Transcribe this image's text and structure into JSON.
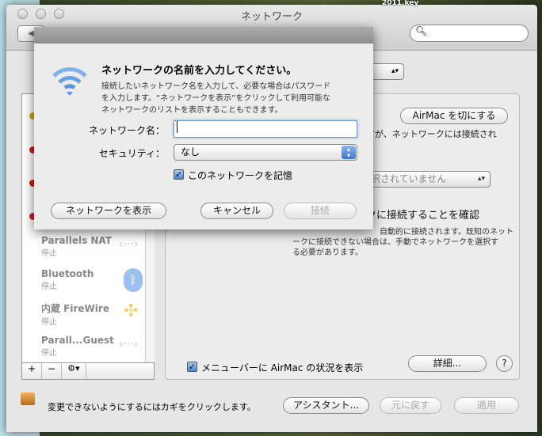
{
  "window": {
    "title": "ネットワーク",
    "search_placeholder": ""
  },
  "desktop": {
    "label": "2011.key"
  },
  "sidebar": {
    "items": [
      {
        "name": "Parallels NAT",
        "status": "停止",
        "icon": "ethernet-icon"
      },
      {
        "name": "Bluetooth",
        "status": "停止",
        "icon": "bluetooth-icon"
      },
      {
        "name": "内蔵 FireWire",
        "status": "停止",
        "icon": "firewire-icon"
      },
      {
        "name": "Parall...Guest",
        "status": "停止",
        "icon": "ethernet-icon"
      }
    ],
    "add": "+",
    "remove": "−",
    "gear": "⚙▾"
  },
  "panel": {
    "airmac_off": "AirMac を切にする",
    "status_text": "ますが、ネットワークには接続され",
    "network_popup": "択されていません",
    "ask_label": "クに接続することを確認",
    "ask_desc1": "自動的に接続されます。既知のネット",
    "ask_desc2": "ークに接続できない場合は、手動でネットワークを選択す",
    "ask_desc3": "る必要があります。",
    "menubar_checkbox": "メニューバーに AirMac の状況を表示",
    "menubar_checked": true,
    "advanced": "詳細...",
    "help": "?"
  },
  "footer": {
    "lock_text": "変更できないようにするにはカギをクリックします。",
    "assistant": "アシスタント...",
    "revert": "元に戻す",
    "apply": "適用"
  },
  "sheet": {
    "title": "ネットワークの名前を入力してください。",
    "desc1": "接続したいネットワーク名を入力して、必要な場合はパスワード",
    "desc2": "を入力します。“ネットワークを表示”をクリックして利用可能な",
    "desc3": "ネットワークのリストを表示することもできます。",
    "name_label": "ネットワーク名：",
    "name_value": "",
    "security_label": "セキュリティ：",
    "security_value": "なし",
    "remember": "このネットワークを記憶",
    "remember_checked": true,
    "show_networks": "ネットワークを表示",
    "cancel": "キャンセル",
    "connect": "接続"
  }
}
